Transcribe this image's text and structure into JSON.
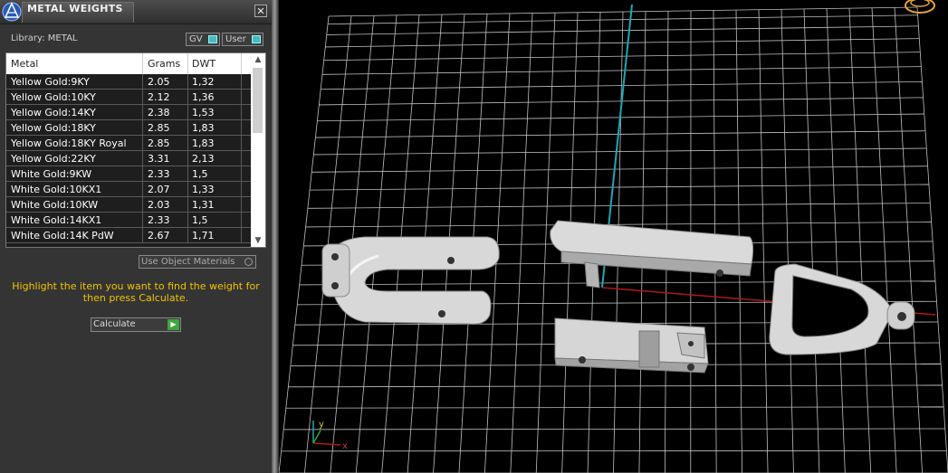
{
  "panel": {
    "title": "METAL WEIGHTS",
    "close_glyph": "✕",
    "library_label": "Library: METAL",
    "gv_label": "GV",
    "user_label": "User",
    "columns": [
      "Metal",
      "Grams",
      "DWT"
    ],
    "rows": [
      {
        "metal": "Yellow Gold:9KY",
        "grams": "2.05",
        "dwt": "1,32"
      },
      {
        "metal": "Yellow Gold:10KY",
        "grams": "2.12",
        "dwt": "1,36"
      },
      {
        "metal": "Yellow Gold:14KY",
        "grams": "2.38",
        "dwt": "1,53"
      },
      {
        "metal": "Yellow Gold:18KY",
        "grams": "2.85",
        "dwt": "1,83"
      },
      {
        "metal": "Yellow Gold:18KY Royal",
        "grams": "2.85",
        "dwt": "1,83"
      },
      {
        "metal": "Yellow Gold:22KY",
        "grams": "3.31",
        "dwt": "2,13"
      },
      {
        "metal": "White Gold:9KW",
        "grams": "2.33",
        "dwt": "1,5"
      },
      {
        "metal": "White Gold:10KX1",
        "grams": "2.07",
        "dwt": "1,33"
      },
      {
        "metal": "White Gold:10KW",
        "grams": "2.03",
        "dwt": "1,31"
      },
      {
        "metal": "White Gold:14KX1",
        "grams": "2.33",
        "dwt": "1,5"
      },
      {
        "metal": "White Gold:14K PdW",
        "grams": "2.67",
        "dwt": "1,71"
      }
    ],
    "use_object_materials_label": "Use Object Materials",
    "hint_text": "Highlight the item you want to find the weight for then press Calculate.",
    "calculate_label": "Calculate"
  },
  "viewport": {
    "axis_x_label": "x",
    "axis_y_label": "y",
    "grid_color": "#bfbfbf",
    "axis_red": "#b01818",
    "axis_cyan": "#1ea7b4",
    "model_color": "#dcdcdc"
  }
}
